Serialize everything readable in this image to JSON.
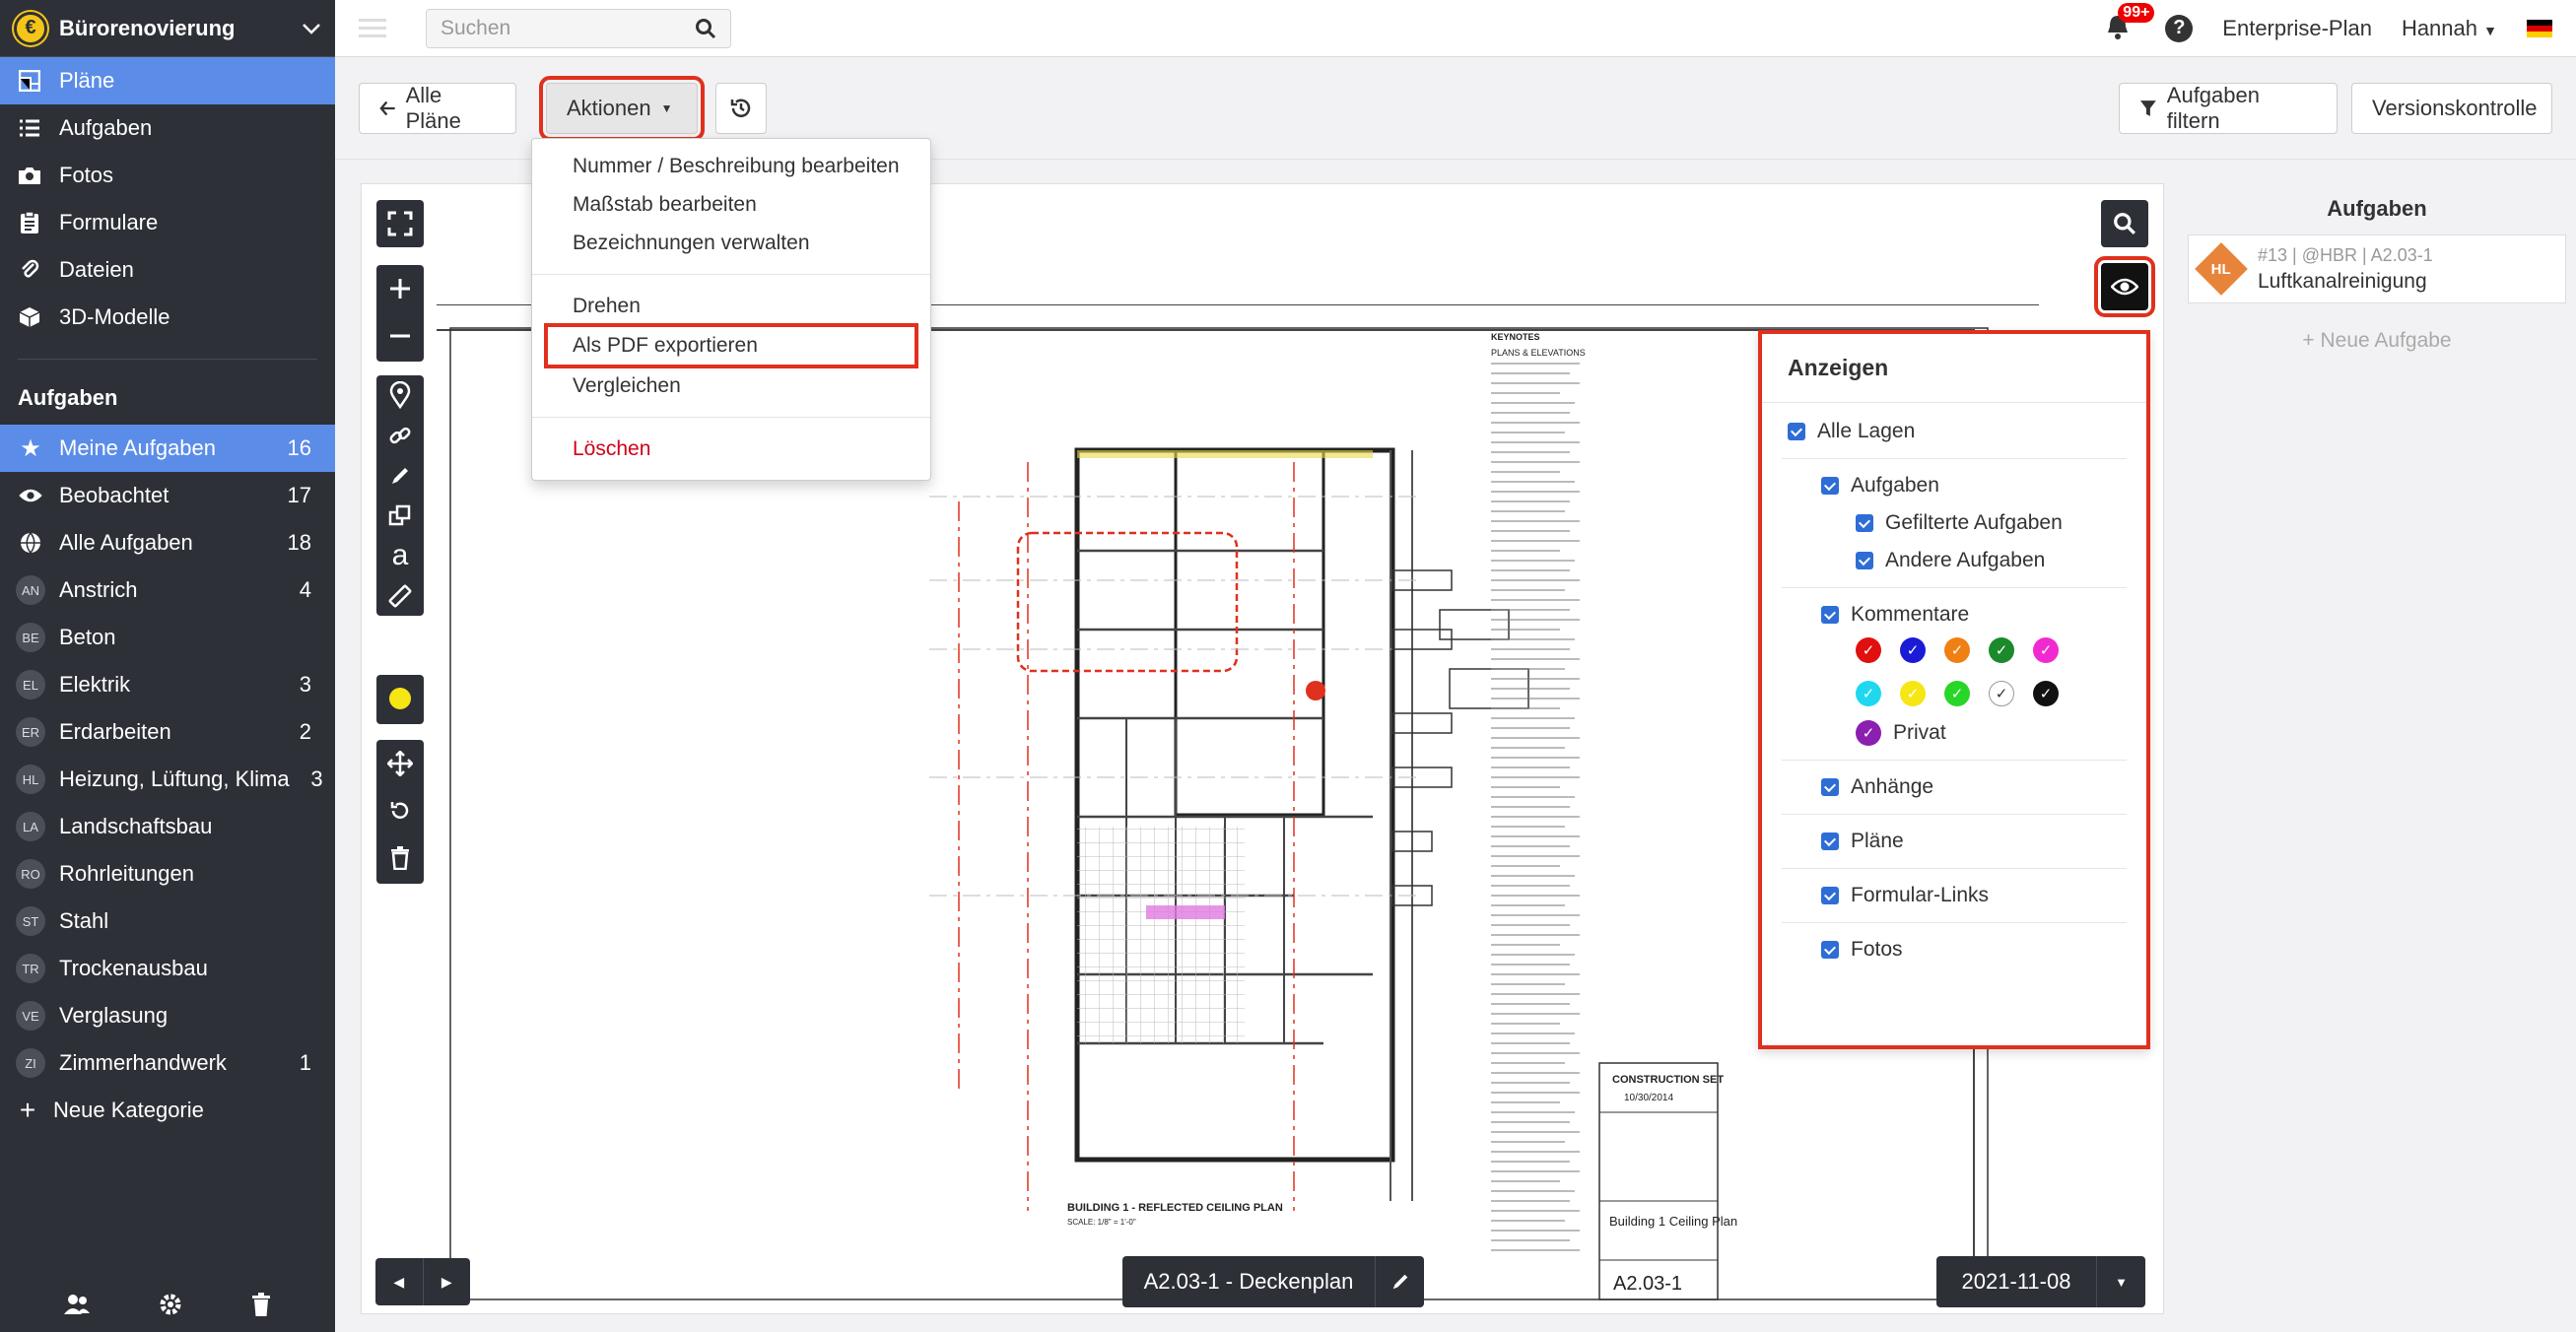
{
  "sidebar": {
    "project": "Bürorenovierung",
    "logo_letter": "€",
    "nav": [
      {
        "label": "Pläne",
        "icon": "plans-icon"
      },
      {
        "label": "Aufgaben",
        "icon": "list-icon"
      },
      {
        "label": "Fotos",
        "icon": "camera-icon"
      },
      {
        "label": "Formulare",
        "icon": "clipboard-icon"
      },
      {
        "label": "Dateien",
        "icon": "paperclip-icon"
      },
      {
        "label": "3D-Modelle",
        "icon": "cube-icon"
      }
    ],
    "tasks_title": "Aufgaben",
    "task_items": [
      {
        "label": "Meine Aufgaben",
        "count": "16",
        "icon": "star"
      },
      {
        "label": "Beobachtet",
        "count": "17",
        "icon": "eye"
      },
      {
        "label": "Alle Aufgaben",
        "count": "18",
        "icon": "globe"
      },
      {
        "label": "Anstrich",
        "count": "4",
        "badge": "AN"
      },
      {
        "label": "Beton",
        "count": "",
        "badge": "BE"
      },
      {
        "label": "Elektrik",
        "count": "3",
        "badge": "EL"
      },
      {
        "label": "Erdarbeiten",
        "count": "2",
        "badge": "ER"
      },
      {
        "label": "Heizung, Lüftung, Klima",
        "count": "3",
        "badge": "HL"
      },
      {
        "label": "Landschaftsbau",
        "count": "",
        "badge": "LA"
      },
      {
        "label": "Rohrleitungen",
        "count": "",
        "badge": "RO"
      },
      {
        "label": "Stahl",
        "count": "",
        "badge": "ST"
      },
      {
        "label": "Trockenausbau",
        "count": "",
        "badge": "TR"
      },
      {
        "label": "Verglasung",
        "count": "",
        "badge": "VE"
      },
      {
        "label": "Zimmerhandwerk",
        "count": "1",
        "badge": "ZI"
      }
    ],
    "new_category": "Neue Kategorie"
  },
  "topbar": {
    "search_placeholder": "Suchen",
    "notif_count": "99+",
    "help": "?",
    "plan": "Enterprise-Plan",
    "user": "Hannah"
  },
  "toolbar": {
    "all_plans": "Alle Pläne",
    "actions": "Aktionen",
    "filter": "Aufgaben filtern",
    "versions": "Versionskontrolle"
  },
  "menu": {
    "items": [
      "Nummer / Beschreibung bearbeiten",
      "Maßstab bearbeiten",
      "Bezeichnungen verwalten",
      "Drehen",
      "Als PDF exportieren",
      "Vergleichen",
      "Löschen"
    ]
  },
  "layers": {
    "title": "Anzeigen",
    "all": "Alle Lagen",
    "tasks": "Aufgaben",
    "filtered": "Gefilterte Aufgaben",
    "other": "Andere Aufgaben",
    "comments": "Kommentare",
    "private": "Privat",
    "attachments": "Anhänge",
    "plans": "Pläne",
    "form_links": "Formular-Links",
    "photos": "Fotos",
    "colors_row1": [
      "#e01010",
      "#1b1bd6",
      "#f07f14",
      "#1a8a2a",
      "#f02ad0"
    ],
    "colors_row2": [
      "#1fd8f0",
      "#f5e614",
      "#28d628",
      "#ffffff",
      "#111111"
    ],
    "private_color": "#8b1fb0"
  },
  "viewer": {
    "sheet": "A2.03-1 - Deckenplan",
    "date": "2021-11-08",
    "plan_title": "BUILDING 1 - REFLECTED CEILING PLAN",
    "plan_scale": "SCALE: 1/8\" = 1'-0\"",
    "title_block": "Building 1 Ceiling Plan",
    "sheet_no": "A2.03-1",
    "construction": "CONSTRUCTION SET",
    "set_date": "10/30/2014",
    "keynotes": "KEYNOTES"
  },
  "tasks_panel": {
    "title": "Aufgaben",
    "task_meta": "#13 | @HBR | A2.03-1",
    "task_name": "Luftkanalreinigung",
    "task_badge": "HL",
    "new_task": "+ Neue Aufgabe"
  }
}
